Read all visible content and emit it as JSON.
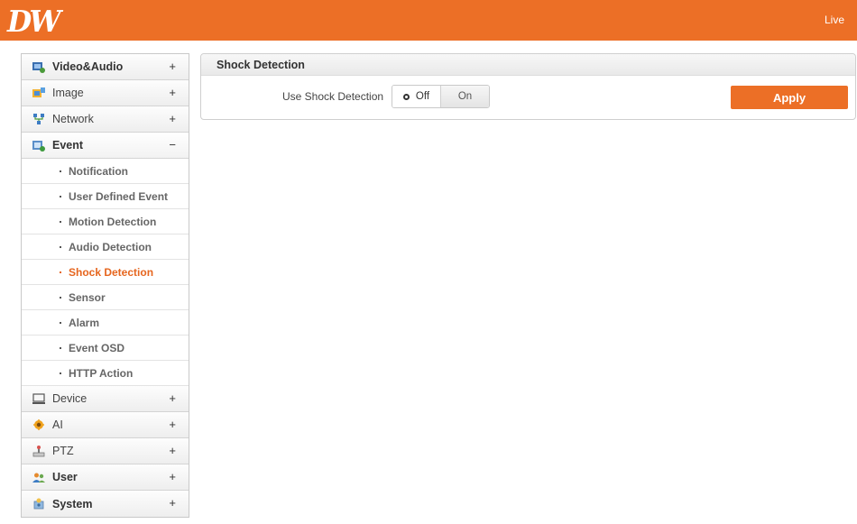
{
  "header": {
    "logo_text": "DW",
    "live_label": "Live",
    "accent_color": "#ec6f26"
  },
  "sidebar": {
    "items": [
      {
        "label": "Video&Audio",
        "icon": "video-audio-icon",
        "toggle": "+"
      },
      {
        "label": "Image",
        "icon": "image-icon",
        "toggle": "+"
      },
      {
        "label": "Network",
        "icon": "network-icon",
        "toggle": "+"
      },
      {
        "label": "Event",
        "icon": "event-icon",
        "toggle": "−",
        "subitems": [
          {
            "label": "Notification"
          },
          {
            "label": "User Defined Event"
          },
          {
            "label": "Motion Detection"
          },
          {
            "label": "Audio Detection"
          },
          {
            "label": "Shock Detection",
            "active": true
          },
          {
            "label": "Sensor"
          },
          {
            "label": "Alarm"
          },
          {
            "label": "Event OSD"
          },
          {
            "label": "HTTP Action"
          }
        ]
      },
      {
        "label": "Device",
        "icon": "device-icon",
        "toggle": "+"
      },
      {
        "label": "AI",
        "icon": "ai-icon",
        "toggle": "+"
      },
      {
        "label": "PTZ",
        "icon": "ptz-icon",
        "toggle": "+"
      },
      {
        "label": "User",
        "icon": "user-icon",
        "toggle": "+"
      },
      {
        "label": "System",
        "icon": "system-icon",
        "toggle": "+"
      }
    ]
  },
  "main": {
    "title": "Shock Detection",
    "field_label": "Use Shock Detection",
    "toggle": {
      "off_label": "Off",
      "on_label": "On",
      "selected": "Off"
    },
    "apply_label": "Apply"
  }
}
